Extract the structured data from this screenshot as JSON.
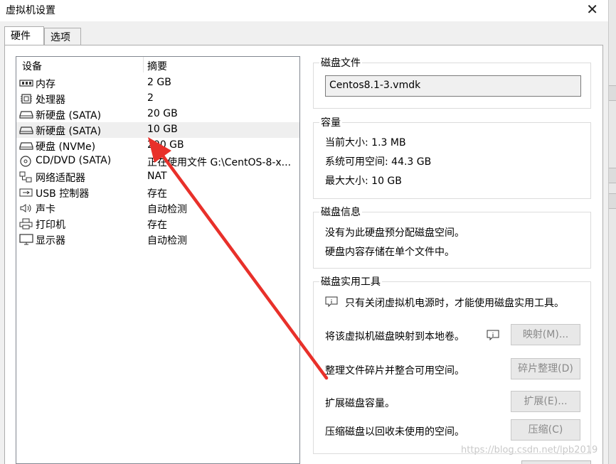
{
  "window": {
    "title": "虚拟机设置",
    "close_glyph": "✕"
  },
  "tabs": [
    {
      "label": "硬件",
      "active": true
    },
    {
      "label": "选项",
      "active": false
    }
  ],
  "device_list": {
    "columns": {
      "device": "设备",
      "summary": "摘要"
    },
    "rows": [
      {
        "icon": "memory-icon",
        "name": "内存",
        "summary": "2 GB"
      },
      {
        "icon": "processor-icon",
        "name": "处理器",
        "summary": "2"
      },
      {
        "icon": "hard-disk-icon",
        "name": "新硬盘 (SATA)",
        "summary": "20 GB"
      },
      {
        "icon": "hard-disk-icon",
        "name": "新硬盘 (SATA)",
        "summary": "10 GB",
        "selected": true
      },
      {
        "icon": "hard-disk-icon",
        "name": "硬盘 (NVMe)",
        "summary": "200 GB"
      },
      {
        "icon": "cd-dvd-icon",
        "name": "CD/DVD (SATA)",
        "summary": "正在使用文件 G:\\CentOS-8-x..."
      },
      {
        "icon": "network-adapter-icon",
        "name": "网络适配器",
        "summary": "NAT"
      },
      {
        "icon": "usb-icon",
        "name": "USB 控制器",
        "summary": "存在"
      },
      {
        "icon": "sound-card-icon",
        "name": "声卡",
        "summary": "自动检测"
      },
      {
        "icon": "printer-icon",
        "name": "打印机",
        "summary": "存在"
      },
      {
        "icon": "display-icon",
        "name": "显示器",
        "summary": "自动检测"
      }
    ]
  },
  "disk_file": {
    "title": "磁盘文件",
    "value": "Centos8.1-3.vmdk"
  },
  "capacity": {
    "title": "容量",
    "current_size": "当前大小: 1.3 MB",
    "available": "系统可用空间: 44.3 GB",
    "max_size": "最大大小: 10 GB"
  },
  "disk_info": {
    "title": "磁盘信息",
    "line1": "没有为此硬盘预分配磁盘空间。",
    "line2": "硬盘内容存储在单个文件中。"
  },
  "disk_utilities": {
    "title": "磁盘实用工具",
    "notice": "只有关闭虚拟机电源时，才能使用磁盘实用工具。",
    "map_text": "将该虚拟机磁盘映射到本地卷。",
    "map_button": "映射(M)...",
    "defrag_text": "整理文件碎片并整合可用空间。",
    "defrag_button": "碎片整理(D)",
    "expand_text": "扩展磁盘容量。",
    "expand_button": "扩展(E)...",
    "compact_text": "压缩磁盘以回收未使用的空间。",
    "compact_button": "压缩(C)"
  },
  "watermark": "https://blog.csdn.net/lpb2019",
  "colors": {
    "annotation_arrow": "#e8302a",
    "selection": "#efefef",
    "disabled_text": "#8a8a8a"
  }
}
